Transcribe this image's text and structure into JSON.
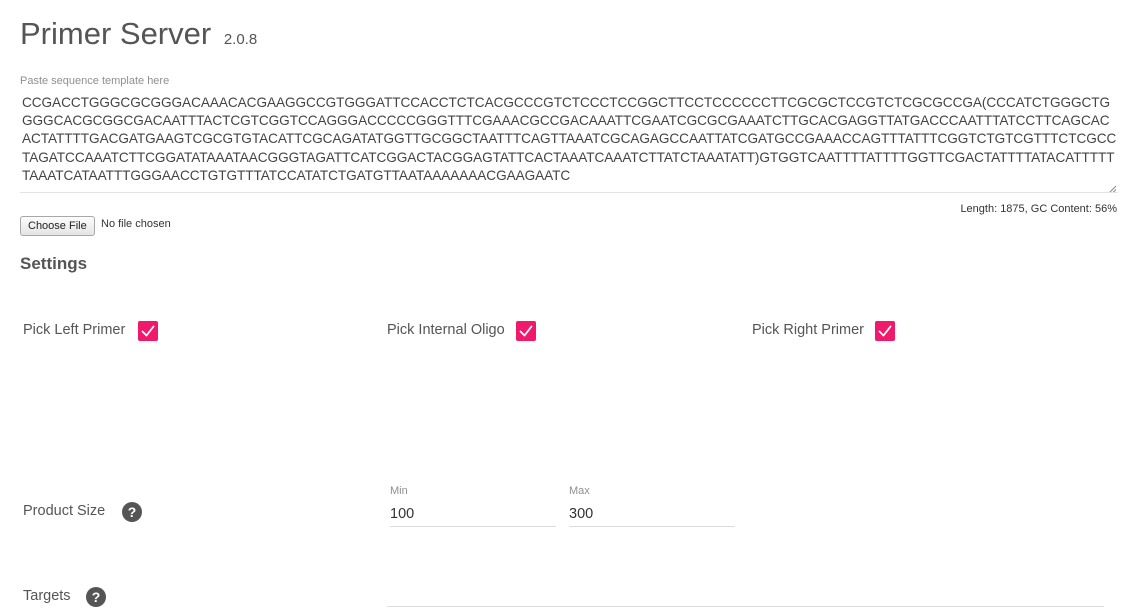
{
  "header": {
    "title": "Primer Server",
    "version": "2.0.8"
  },
  "sequence": {
    "label": "Paste sequence template here",
    "value": "CCGACCTGGGCGCGGGACAAACACGAAGGCCGTGGGATTCCACCTCTCACGCCCGTCTCCCTCCGGCTTCCTCCCCCCTTCGCGCTCCGTCTCGCGCCGA(CCCATCTGGGCTGGGGCACGCGGCGACAATTTACTCGTCGGTCCAGGGACCCCCGGGTTTCGAAACGCCGACAAATTCGAATCGCGCGAAATCTTGCACGAGGTTATGACCCAATTTATCCTTCAGCACACTATTTTGACGATGAAGTCGCGTGTACATTCGCAGATATGGTTGCGGCTAATTTCAGTTAAATCGCAGAGCCAATTATCGATGCCGAAACCAGTTTATTTCGGTCTGTCGTTTCTCGCCTAGATCCAAATCTTCGGATATAAATAACGGGTAGATTCATCGGACTACGGAGTATTCACTAAATCAAATCTTATCTAAATATT)GTGGTCAATTTTATTTTGGTTCGACTATTTTATACATTTTTTAAATCATAATTTGGGAACCTGTGTTTATCCATATCTGATGTTAATAAAAAAACGAAGAATC",
    "stats": "Length: 1875, GC Content: 56%"
  },
  "file": {
    "button_label": "Choose File",
    "status": "No file chosen"
  },
  "settings": {
    "heading": "Settings",
    "pick_left": {
      "label": "Pick Left Primer",
      "checked": true
    },
    "pick_internal": {
      "label": "Pick Internal Oligo",
      "checked": true
    },
    "pick_right": {
      "label": "Pick Right Primer",
      "checked": true
    },
    "product_size": {
      "label": "Product Size",
      "min_label": "Min",
      "min_value": "100",
      "max_label": "Max",
      "max_value": "300"
    },
    "targets": {
      "label": "Targets",
      "value": ""
    },
    "help_glyph": "?"
  },
  "colors": {
    "accent": "#f0196c",
    "text": "#555555",
    "help_bg": "#555555"
  },
  "icons": {
    "checkbox": "checkmark-icon",
    "help": "question-circle-icon",
    "resize": "resize-grip-icon"
  }
}
